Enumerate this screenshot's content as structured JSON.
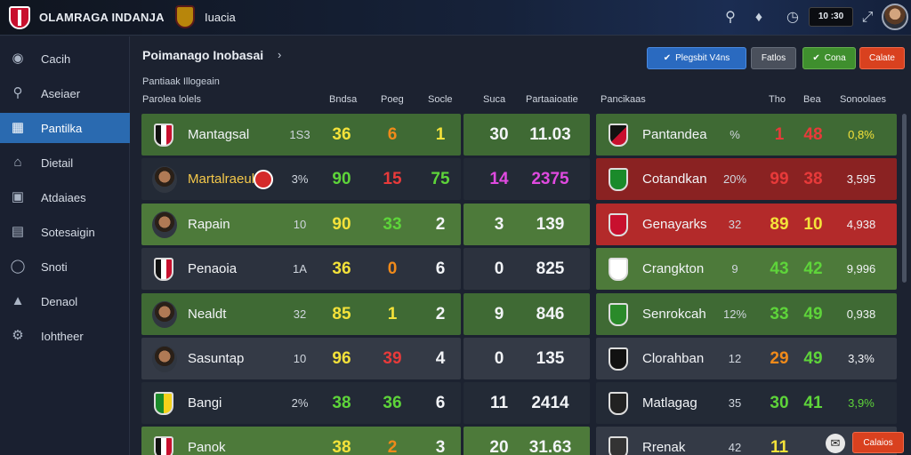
{
  "topbar": {
    "app_title": "OLAMRAGA INDANJA",
    "subtitle": "Iuacia",
    "score": "10 :30"
  },
  "sidebar": {
    "items": [
      {
        "label": "Cacih",
        "icon": "globe-icon",
        "active": false
      },
      {
        "label": "Aseiaer",
        "icon": "search-icon",
        "active": false
      },
      {
        "label": "Pantilka",
        "icon": "tactics-icon",
        "active": true
      },
      {
        "label": "Dietail",
        "icon": "home-icon",
        "active": false
      },
      {
        "label": "Atdaiaes",
        "icon": "building-icon",
        "active": false
      },
      {
        "label": "Sotesaigin",
        "icon": "chart-icon",
        "active": false
      },
      {
        "label": "Snoti",
        "icon": "circle-icon",
        "active": false
      },
      {
        "label": "Denaol",
        "icon": "stadium-icon",
        "active": false
      },
      {
        "label": "Iohtheer",
        "icon": "settings-icon",
        "active": false
      }
    ]
  },
  "main": {
    "title": "Poimanago Inobasai",
    "subtitle": "Pantiaak Illogeain",
    "buttons": {
      "primary": "Plegsbit V4ns",
      "grey": "Fatlos",
      "green": "Cona",
      "red": "Calate"
    },
    "left_headers": [
      "Parolea lolels",
      "Bndsa",
      "Poeg",
      "Socle",
      "Suca",
      "Partaaioatie"
    ],
    "right_headers": [
      "Pancikaas",
      "Tho",
      "Bea",
      "Sonoolaes"
    ],
    "left_rows": [
      {
        "name": "Mantagsal",
        "pct": "1S3",
        "a": "36",
        "b": "6",
        "c": "1",
        "d": "30",
        "e": "11.03",
        "crest": "flag",
        "bg": "#3f6a34",
        "rbg": "#3f6a34",
        "ac": "#f4e23a",
        "bc": "#f08a1a",
        "cc": "#f4e23a"
      },
      {
        "name": "Martalraeul",
        "pct": "3%",
        "a": "90",
        "b": "15",
        "c": "75",
        "d": "14",
        "e": "2375",
        "crest": "face",
        "bg": "#232a36",
        "rbg": "#232a36",
        "ac": "#5ed43a",
        "bc": "#e83a3a",
        "cc": "#5ed43a",
        "dc": "#e04ae0",
        "ec": "#e04ae0",
        "namecolor": "#f4c84a"
      },
      {
        "name": "Rapain",
        "pct": "10",
        "a": "90",
        "b": "33",
        "c": "2",
        "d": "3",
        "e": "139",
        "crest": "face",
        "bg": "#4d7a3a",
        "rbg": "#4d7a3a",
        "ac": "#f4e23a",
        "bc": "#5ed43a",
        "cc": "#f2f4f7"
      },
      {
        "name": "Penaoia",
        "pct": "1A",
        "a": "36",
        "b": "0",
        "c": "6",
        "d": "0",
        "e": "825",
        "crest": "flag",
        "bg": "#2c323e",
        "rbg": "#2c323e",
        "ac": "#f4e23a",
        "bc": "#f08a1a",
        "cc": "#f2f4f7"
      },
      {
        "name": "Nealdt",
        "pct": "32",
        "a": "85",
        "b": "1",
        "c": "2",
        "d": "9",
        "e": "846",
        "crest": "face",
        "bg": "#3f6a34",
        "rbg": "#3f6a34",
        "ac": "#f4e23a",
        "bc": "#f4e23a",
        "cc": "#f2f4f7"
      },
      {
        "name": "Sasuntap",
        "pct": "10",
        "a": "96",
        "b": "39",
        "c": "4",
        "d": "0",
        "e": "135",
        "crest": "face",
        "bg": "#343a46",
        "rbg": "#343a46",
        "ac": "#f4e23a",
        "bc": "#e83a3a",
        "cc": "#f2f4f7"
      },
      {
        "name": "Bangi",
        "pct": "2%",
        "a": "38",
        "b": "36",
        "c": "6",
        "d": "11",
        "e": "2414",
        "crest": "flag-green",
        "bg": "#232a36",
        "rbg": "#232a36",
        "ac": "#5ed43a",
        "bc": "#5ed43a",
        "cc": "#f2f4f7"
      },
      {
        "name": "Panok",
        "pct": "",
        "a": "38",
        "b": "2",
        "c": "3",
        "d": "20",
        "e": "31.63",
        "crest": "flag",
        "bg": "#4d7a3a",
        "rbg": "#4d7a3a",
        "ac": "#f4e23a",
        "bc": "#f08a1a",
        "cc": "#f2f4f7"
      }
    ],
    "right_rows": [
      {
        "name": "Pantandea",
        "pct": "%",
        "a": "1",
        "b": "48",
        "c": "0,8%",
        "bg": "#3f6a34",
        "ac": "#e83a3a",
        "bc": "#e83a3a",
        "cc": "#f4e23a"
      },
      {
        "name": "Cotandkan",
        "pct": "20%",
        "a": "99",
        "b": "38",
        "c": "3,595",
        "bg": "#8a2222",
        "ac": "#e83a3a",
        "bc": "#e83a3a",
        "cc": "#f2f4f7"
      },
      {
        "name": "Genayarks",
        "pct": "32",
        "a": "89",
        "b": "10",
        "c": "4,938",
        "bg": "#b32a2a",
        "ac": "#f4e23a",
        "bc": "#f4e23a",
        "cc": "#f2f4f7"
      },
      {
        "name": "Crangkton",
        "pct": "9",
        "a": "43",
        "b": "42",
        "c": "9,996",
        "bg": "#4d7a3a",
        "ac": "#5ed43a",
        "bc": "#5ed43a",
        "cc": "#f2f4f7"
      },
      {
        "name": "Senrokcah",
        "pct": "12%",
        "a": "33",
        "b": "49",
        "c": "0,938",
        "bg": "#3f6a34",
        "ac": "#5ed43a",
        "bc": "#5ed43a",
        "cc": "#f2f4f7"
      },
      {
        "name": "Clorahban",
        "pct": "12",
        "a": "29",
        "b": "49",
        "c": "3,3%",
        "bg": "#343a46",
        "ac": "#f08a1a",
        "bc": "#5ed43a",
        "cc": "#f2f4f7"
      },
      {
        "name": "Matlagag",
        "pct": "35",
        "a": "30",
        "b": "41",
        "c": "3,9%",
        "bg": "#232a36",
        "ac": "#5ed43a",
        "bc": "#5ed43a",
        "cc": "#5ed43a"
      },
      {
        "name": "Rrenak",
        "pct": "42",
        "a": "11",
        "b": "",
        "c": "",
        "bg": "#343a46",
        "ac": "#f4e23a",
        "bc": "#f4e23a",
        "cc": "#f2f4f7"
      }
    ],
    "bottom_button": "Calaios"
  },
  "colors": {
    "accent": "#2a6ab0",
    "green": "#3f8f2e",
    "red": "#d9411f"
  }
}
